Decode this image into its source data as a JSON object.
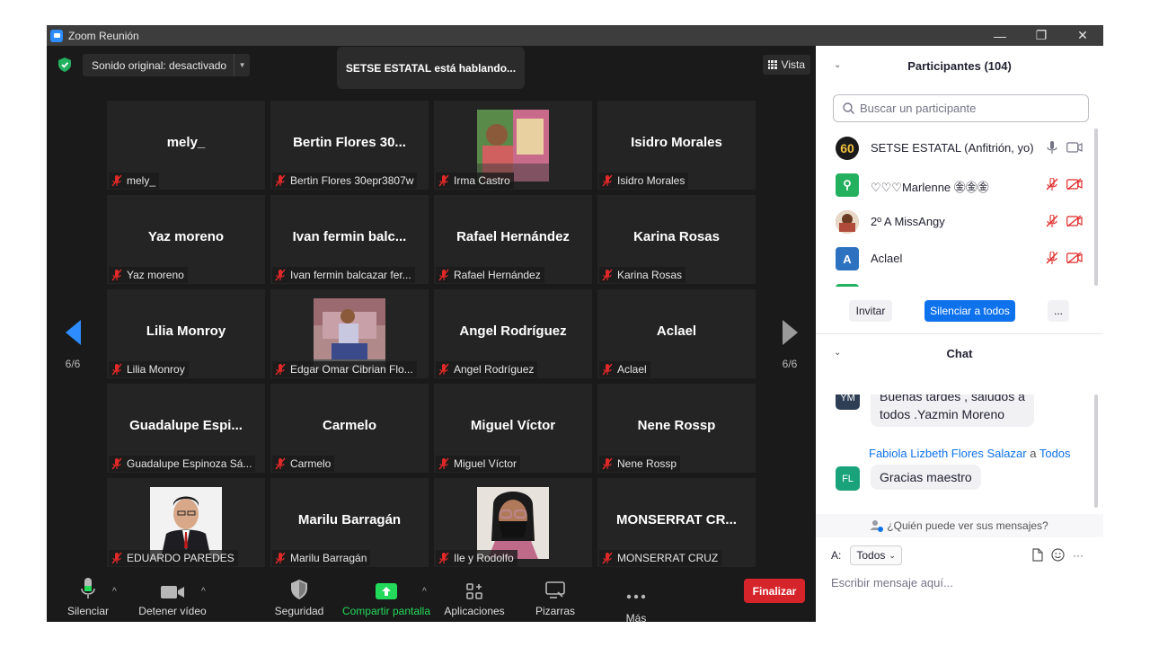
{
  "window": {
    "title": "Zoom Reunión",
    "controls": [
      "—",
      "❐",
      "✕"
    ]
  },
  "meeting": {
    "audio_label": "Sonido original: desactivado",
    "speaking": "SETSE ESTATAL está hablando...",
    "view_label": "Vista",
    "page_left": "6/6",
    "page_right": "6/6"
  },
  "tiles": [
    {
      "display": "mely_",
      "label": "mely_"
    },
    {
      "display": "Bertin Flores 30...",
      "label": "Bertin Flores 30epr3807w"
    },
    {
      "display": "",
      "label": "Irma Castro"
    },
    {
      "display": "Isidro Morales",
      "label": "Isidro Morales"
    },
    {
      "display": "Yaz moreno",
      "label": "Yaz moreno"
    },
    {
      "display": "Ivan fermin balc...",
      "label": "Ivan fermin balcazar fer..."
    },
    {
      "display": "Rafael Hernández",
      "label": "Rafael Hernández"
    },
    {
      "display": "Karina Rosas",
      "label": "Karina Rosas"
    },
    {
      "display": "Lilia Monroy",
      "label": "Lilia Monroy"
    },
    {
      "display": "",
      "label": "Edgar Omar Cibrian Flo..."
    },
    {
      "display": "Angel Rodríguez",
      "label": "Angel Rodríguez"
    },
    {
      "display": "Aclael",
      "label": "Aclael"
    },
    {
      "display": "Guadalupe  Espi...",
      "label": "Guadalupe Espinoza Sá..."
    },
    {
      "display": "Carmelo",
      "label": "Carmelo"
    },
    {
      "display": "Miguel Víctor",
      "label": "Miguel Víctor"
    },
    {
      "display": "Nene Rossp",
      "label": "Nene Rossp"
    },
    {
      "display": "",
      "label": "EDUARDO PAREDES"
    },
    {
      "display": "Marilu Barragán",
      "label": "Marilu Barragán"
    },
    {
      "display": "",
      "label": "Ile y Rodolfo"
    },
    {
      "display": "MONSERRAT  CR...",
      "label": "MONSERRAT CRUZ"
    }
  ],
  "toolbar": {
    "mute": "Silenciar",
    "video": "Detener vídeo",
    "security": "Seguridad",
    "share": "Compartir pantalla",
    "apps": "Aplicaciones",
    "whiteboards": "Pizarras",
    "more": "Más",
    "end": "Finalizar"
  },
  "participants": {
    "title": "Participantes (104)",
    "search_placeholder": "Buscar un participante",
    "list": [
      {
        "avatar": "60",
        "name": "SETSE ESTATAL (Anfitrión, yo)",
        "color": "#1a1a1a"
      },
      {
        "avatar": "⚲",
        "name": "♡♡♡Marlenne ㊎㊎㊎",
        "color": "#23b15f"
      },
      {
        "avatar": "",
        "name": "2º A  MissAngy",
        "color": "#c87a4a"
      },
      {
        "avatar": "A",
        "name": "Aclael",
        "color": "#2d72c0"
      }
    ],
    "invite": "Invitar",
    "mute_all": "Silenciar a todos",
    "more": "..."
  },
  "chat": {
    "title": "Chat",
    "messages": [
      {
        "avatar": "YM",
        "line1": "Buenas tardes  , saludos a",
        "line2": "todos  .Yazmin Moreno"
      },
      {
        "avatar": "FL",
        "sender": "Fabiola Lizbeth Flores Salazar",
        "to_word": "a",
        "to": "Todos",
        "text": "Gracias maestro"
      }
    ],
    "who_can_see": "¿Quién puede ver sus mensajes?",
    "to_label": "A:",
    "to_value": "Todos",
    "input_placeholder": "Escribir mensaje aquí...",
    "more": "···"
  },
  "colors": {
    "accent": "#2d8cff",
    "share_green": "#23d959",
    "end_red": "#d6242b",
    "muted_red": "#e02828"
  }
}
